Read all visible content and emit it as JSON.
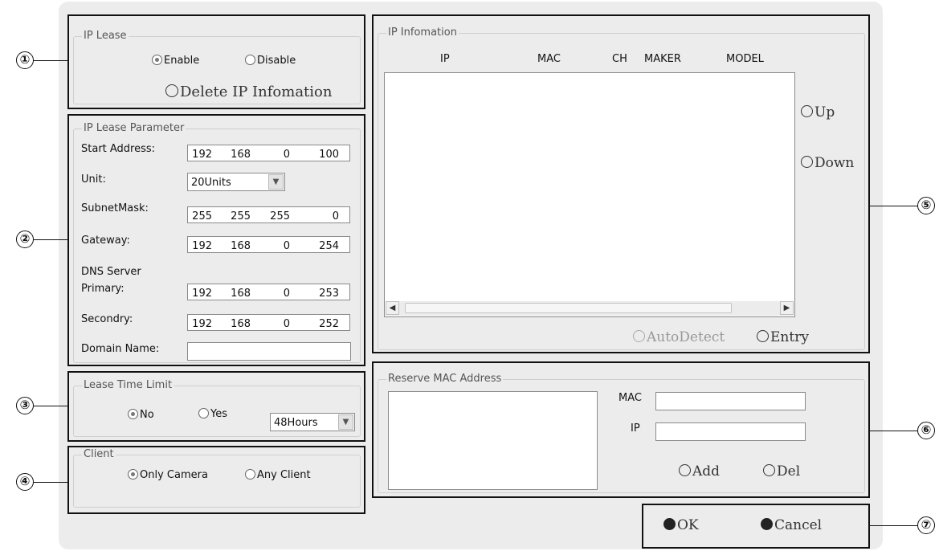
{
  "ip_lease": {
    "title": "IP Lease",
    "enable": "Enable",
    "disable": "Disable",
    "delete_info": "Delete IP Infomation"
  },
  "ip_lease_param": {
    "title": "IP Lease Parameter",
    "start_address_label": "Start Address:",
    "start_address": [
      "192",
      "168",
      "0",
      "100"
    ],
    "unit_label": "Unit:",
    "unit_value": "20Units",
    "subnet_label": "SubnetMask:",
    "subnet": [
      "255",
      "255",
      "255",
      "0"
    ],
    "gateway_label": "Gateway:",
    "gateway": [
      "192",
      "168",
      "0",
      "254"
    ],
    "dns_label": "DNS Server",
    "primary_label": "Primary:",
    "primary": [
      "192",
      "168",
      "0",
      "253"
    ],
    "secondary_label": "Secondry:",
    "secondary": [
      "192",
      "168",
      "0",
      "252"
    ],
    "domain_label": "Domain Name:",
    "domain_value": ""
  },
  "lease_time": {
    "title": "Lease Time Limit",
    "no": "No",
    "yes": "Yes",
    "duration": "48Hours"
  },
  "client": {
    "title": "Client",
    "only_camera": "Only Camera",
    "any_client": "Any Client"
  },
  "ip_info": {
    "title": "IP Infomation",
    "columns": [
      "IP",
      "MAC",
      "CH",
      "MAKER",
      "MODEL"
    ],
    "up": "Up",
    "down": "Down",
    "autodetect": "AutoDetect",
    "entry": "Entry"
  },
  "reserve": {
    "title": "Reserve MAC Address",
    "mac_label": "MAC",
    "ip_label": "IP",
    "mac_value": "",
    "ip_value": "",
    "add": "Add",
    "del": "Del"
  },
  "footer": {
    "ok": "OK",
    "cancel": "Cancel"
  },
  "callouts": [
    "①",
    "②",
    "③",
    "④",
    "⑤",
    "⑥",
    "⑦"
  ]
}
